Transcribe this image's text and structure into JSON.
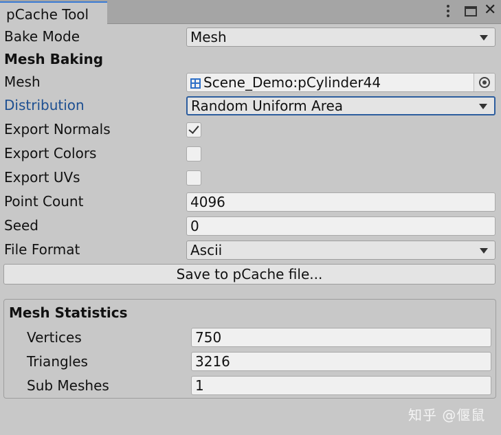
{
  "window": {
    "tab_title": "pCache Tool"
  },
  "bake_mode": {
    "label": "Bake Mode",
    "value": "Mesh"
  },
  "section_title": "Mesh Baking",
  "mesh": {
    "label": "Mesh",
    "value": "Scene_Demo:pCylinder44"
  },
  "distribution": {
    "label": "Distribution",
    "value": "Random Uniform Area"
  },
  "export_normals": {
    "label": "Export Normals",
    "checked": true
  },
  "export_colors": {
    "label": "Export Colors",
    "checked": false
  },
  "export_uvs": {
    "label": "Export UVs",
    "checked": false
  },
  "point_count": {
    "label": "Point Count",
    "value": "4096"
  },
  "seed": {
    "label": "Seed",
    "value": "0"
  },
  "file_format": {
    "label": "File Format",
    "value": "Ascii"
  },
  "save_button": "Save to pCache file...",
  "stats": {
    "title": "Mesh Statistics",
    "vertices": {
      "label": "Vertices",
      "value": "750"
    },
    "triangles": {
      "label": "Triangles",
      "value": "3216"
    },
    "sub_meshes": {
      "label": "Sub Meshes",
      "value": "1"
    }
  },
  "watermark": "知乎 @偃鼠",
  "colors": {
    "accent": "#3a7bd5",
    "focus_border": "#2c5d9e",
    "label_blue": "#1d4f91",
    "panel": "#c8c8c8"
  }
}
